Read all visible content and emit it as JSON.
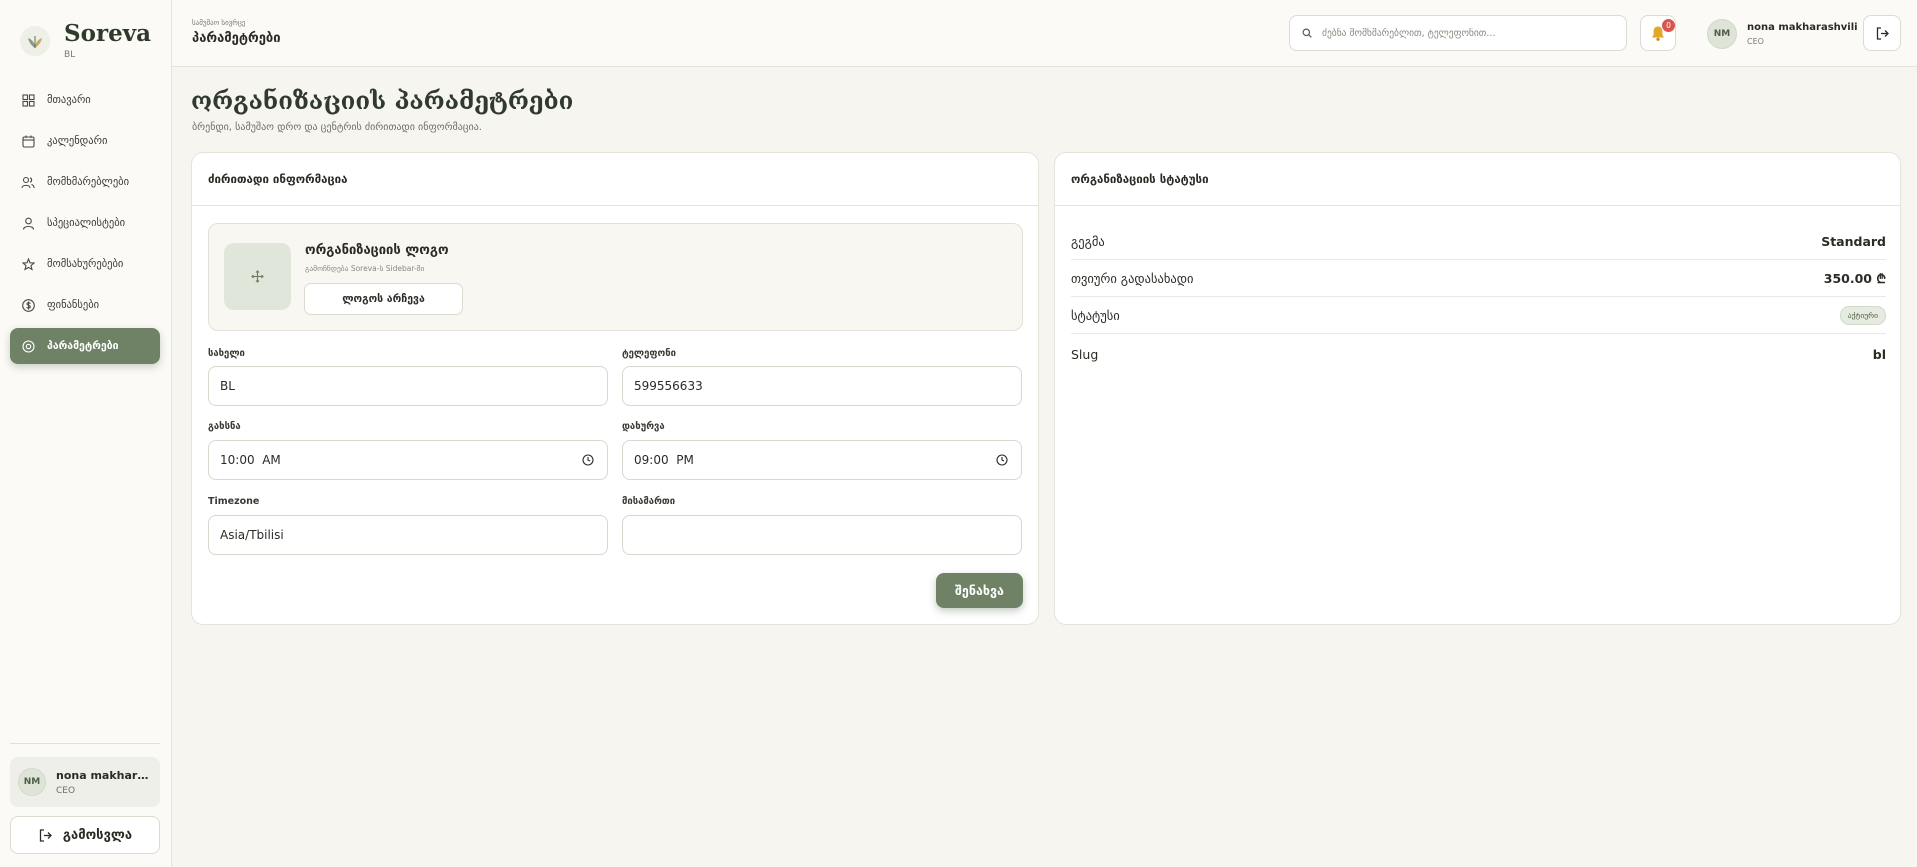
{
  "brand": {
    "name": "Soreva",
    "sub": "BL"
  },
  "sidebar": {
    "items": [
      {
        "label": "მთავარი",
        "icon": "grid-icon",
        "active": false
      },
      {
        "label": "კალენდარი",
        "icon": "calendar-icon",
        "active": false
      },
      {
        "label": "მომხმარებლები",
        "icon": "users-icon",
        "active": false
      },
      {
        "label": "სპეციალისტები",
        "icon": "user-icon",
        "active": false
      },
      {
        "label": "მომსახურებები",
        "icon": "star-icon",
        "active": false
      },
      {
        "label": "ფინანსები",
        "icon": "dollar-icon",
        "active": false
      },
      {
        "label": "პარამეტრები",
        "icon": "settings-icon",
        "active": true
      }
    ],
    "user": {
      "initials": "NM",
      "name": "nona makharas...",
      "role": "CEO"
    },
    "logout_label": "გამოსვლა"
  },
  "topbar": {
    "subtitle": "სამუშაო სივრცე",
    "title": "პარამეტრები",
    "search_placeholder": "ძებნა მომხმარებლით, ტელეფონით...",
    "notifications_count": "0",
    "user": {
      "initials": "NM",
      "name": "nona makharashvili",
      "role": "CEO"
    }
  },
  "page": {
    "title": "ორგანიზაციის პარამეტრები",
    "subtitle": "ბრენდი, სამუშაო დრო და ცენტრის ძირითადი ინფორმაცია."
  },
  "main_card": {
    "title": "ძირითადი ინფორმაცია",
    "logo": {
      "title": "ორგანიზაციის ლოგო",
      "hint": "გამოჩნდება Soreva-ს Sidebar-ში",
      "button": "ლოგოს არჩევა"
    },
    "fields": {
      "name": {
        "label": "სახელი",
        "value": "BL"
      },
      "phone": {
        "label": "ტელეფონი",
        "value": "599556633"
      },
      "open": {
        "label": "გახსნა",
        "value": "10:00  AM"
      },
      "close": {
        "label": "დახურვა",
        "value": "09:00  PM"
      },
      "timezone": {
        "label": "Timezone",
        "value": "Asia/Tbilisi"
      },
      "address": {
        "label": "მისამართი",
        "value": ""
      }
    },
    "save_label": "შენახვა"
  },
  "status_card": {
    "title": "ორგანიზაციის სტატუსი",
    "rows": [
      {
        "label": "გეგმა",
        "value": "Standard"
      },
      {
        "label": "თვიური გადასახადი",
        "value": "350.00 ₾"
      },
      {
        "label": "სტატუსი",
        "value": "აქტიური"
      },
      {
        "label": "Slug",
        "value": "bl"
      }
    ]
  },
  "colors": {
    "accent": "#6f8266",
    "background": "#f6f5f0",
    "badge": "#d9534f"
  }
}
